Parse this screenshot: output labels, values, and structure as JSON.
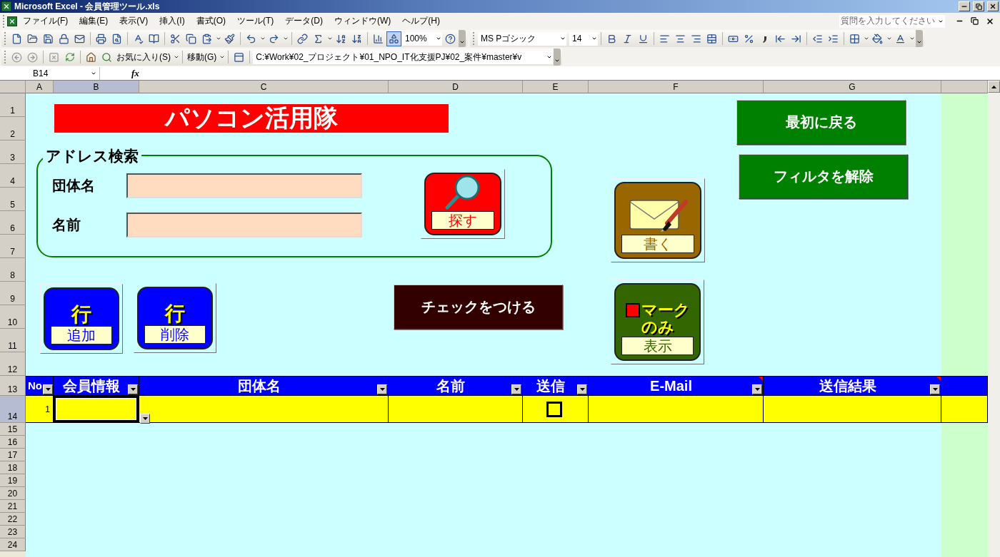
{
  "window": {
    "title": "Microsoft Excel - 会員管理ツール.xls"
  },
  "menu_bar": {
    "items": [
      "ファイル(F)",
      "編集(E)",
      "表示(V)",
      "挿入(I)",
      "書式(O)",
      "ツール(T)",
      "データ(D)",
      "ウィンドウ(W)",
      "ヘルプ(H)"
    ],
    "help_placeholder": "質問を入力してください"
  },
  "standard_toolbar": {
    "zoom": "100%",
    "drawing_pressed": true,
    "font": "MS Pゴシック",
    "font_size": "14"
  },
  "web_toolbar": {
    "favorites": "お気に入り(S)",
    "go": "移動(G)",
    "address": "C:¥Work¥02_プロジェクト¥01_NPO_IT化支援PJ¥02_案件¥master¥v"
  },
  "formula_bar": {
    "name_box": "B14",
    "fx": "fx"
  },
  "sheet": {
    "column_headers": [
      {
        "label": "A",
        "selected": false
      },
      {
        "label": "B",
        "selected": true
      },
      {
        "label": "C",
        "selected": false
      },
      {
        "label": "D",
        "selected": false
      },
      {
        "label": "E",
        "selected": false
      },
      {
        "label": "F",
        "selected": false
      },
      {
        "label": "G",
        "selected": false
      }
    ],
    "row_headers": [
      {
        "label": "1",
        "selected": false
      },
      {
        "label": "2",
        "selected": false
      },
      {
        "label": "3",
        "selected": false
      },
      {
        "label": "4",
        "selected": false
      },
      {
        "label": "5",
        "selected": false
      },
      {
        "label": "6",
        "selected": false
      },
      {
        "label": "7",
        "selected": false
      },
      {
        "label": "8",
        "selected": false
      },
      {
        "label": "9",
        "selected": false
      },
      {
        "label": "10",
        "selected": false
      },
      {
        "label": "11",
        "selected": false
      },
      {
        "label": "12",
        "selected": false
      },
      {
        "label": "13",
        "selected": false
      },
      {
        "label": "14",
        "selected": true
      },
      {
        "label": "15",
        "selected": false
      },
      {
        "label": "16",
        "selected": false
      },
      {
        "label": "17",
        "selected": false
      },
      {
        "label": "18",
        "selected": false
      },
      {
        "label": "19",
        "selected": false
      },
      {
        "label": "20",
        "selected": false
      },
      {
        "label": "21",
        "selected": false
      },
      {
        "label": "22",
        "selected": false
      },
      {
        "label": "23",
        "selected": false
      },
      {
        "label": "24",
        "selected": false
      }
    ],
    "title_banner": {
      "text": "パソコン活用隊",
      "color": "#ff0000"
    },
    "search_group": {
      "legend": "アドレス検索",
      "fields": [
        {
          "label": "団体名"
        },
        {
          "label": "名前"
        }
      ]
    },
    "buttons": [
      {
        "kind": "text",
        "label": "最初に戻る",
        "color": "#008000"
      },
      {
        "kind": "text",
        "label": "フィルタを解除",
        "color": "#008000"
      },
      {
        "kind": "icon",
        "label": "探す",
        "color": "#ff0000"
      },
      {
        "kind": "icon",
        "label": "書く",
        "color": "#996600"
      },
      {
        "kind": "icon",
        "caption": [
          "行"
        ],
        "label": "追加",
        "color": "#0000ff"
      },
      {
        "kind": "icon",
        "caption": [
          "行"
        ],
        "label": "削除",
        "color": "#0000ff"
      },
      {
        "kind": "text",
        "label": "チェックをつける",
        "color": "#330000"
      },
      {
        "kind": "icon",
        "caption": [
          "マーク",
          "のみ"
        ],
        "label": "表示",
        "color": "#336600"
      }
    ]
  },
  "table": {
    "headers": [
      {
        "label": "No",
        "has_comment": false
      },
      {
        "label": "会員情報",
        "has_comment": false
      },
      {
        "label": "団体名",
        "has_comment": false
      },
      {
        "label": "名前",
        "has_comment": false
      },
      {
        "label": "送信",
        "has_comment": false
      },
      {
        "label": "E-Mail",
        "has_comment": true
      },
      {
        "label": "送信結果",
        "has_comment": true
      }
    ],
    "rows": [
      {
        "no": "1",
        "cells": [
          {
            "kind": "text",
            "selected": true
          },
          {
            "kind": "text",
            "selected": false
          },
          {
            "kind": "text",
            "selected": false
          },
          {
            "kind": "checkbox",
            "checked": false,
            "selected": false
          },
          {
            "kind": "text",
            "selected": false
          },
          {
            "kind": "text",
            "selected": false
          }
        ]
      }
    ]
  }
}
